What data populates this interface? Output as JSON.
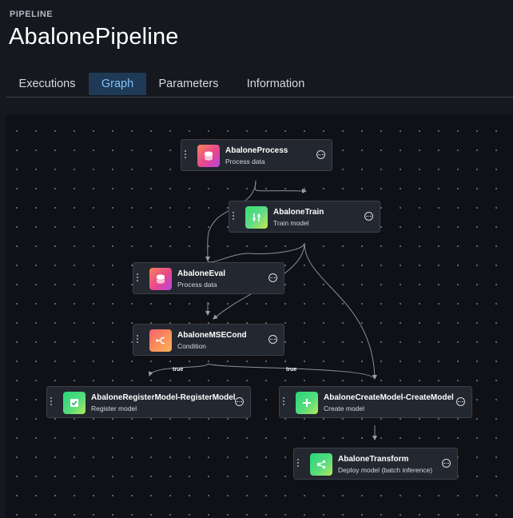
{
  "header": {
    "breadcrumb": "PIPELINE",
    "title": "AbalonePipeline"
  },
  "tabs": [
    {
      "label": "Executions",
      "active": false
    },
    {
      "label": "Graph",
      "active": true
    },
    {
      "label": "Parameters",
      "active": false
    },
    {
      "label": "Information",
      "active": false
    }
  ],
  "graph": {
    "nodes": [
      {
        "name": "AbaloneProcess",
        "subtitle": "Process data",
        "icon": "database-icon"
      },
      {
        "name": "AbaloneTrain",
        "subtitle": "Train model",
        "icon": "sliders-icon"
      },
      {
        "name": "AbaloneEval",
        "subtitle": "Process data",
        "icon": "database-icon"
      },
      {
        "name": "AbaloneMSECond",
        "subtitle": "Condition",
        "icon": "branch-icon"
      },
      {
        "name": "AbaloneRegisterModel-RegisterModel",
        "subtitle": "Register model",
        "icon": "register-check-icon"
      },
      {
        "name": "AbaloneCreateModel-CreateModel",
        "subtitle": "Create model",
        "icon": "plus-icon"
      },
      {
        "name": "AbaloneTransform",
        "subtitle": "Deploy model (batch inference)",
        "icon": "share-icon"
      }
    ],
    "edge_labels": [
      "true",
      "true"
    ]
  },
  "colors": {
    "active_tab_bg": "#1e3a56",
    "active_tab_text": "#7fc2ff",
    "canvas_bg": "#0f1116",
    "node_bg": "#232730"
  }
}
